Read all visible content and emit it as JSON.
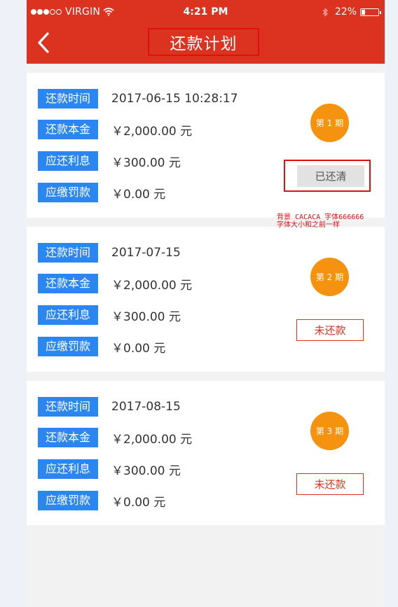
{
  "status_bar": {
    "carrier": "VIRGIN",
    "time": "4:21 PM",
    "battery_pct": "22%",
    "battery_level": 0.22
  },
  "header": {
    "title": "还款计划",
    "back_icon": "chevron-left-icon"
  },
  "colors": {
    "header_bg": "#dc3220",
    "label_bg": "#2b86f2",
    "period_badge": "#f5920f",
    "paid_bg": "#e2e2e2",
    "annotation": "#e01010"
  },
  "plans": [
    {
      "period": "第 1 期",
      "status": "已还清",
      "fields": [
        {
          "label": "还款时间",
          "value": "2017-06-15  10:28:17"
        },
        {
          "label": "还款本金",
          "value": "￥2,000.00 元"
        },
        {
          "label": "应还利息",
          "value": "￥300.00 元"
        },
        {
          "label": "应缴罚款",
          "value": "￥0.00 元"
        }
      ]
    },
    {
      "period": "第 2 期",
      "status": "未还款",
      "fields": [
        {
          "label": "还款时间",
          "value": "2017-07-15"
        },
        {
          "label": "还款本金",
          "value": "￥2,000.00 元"
        },
        {
          "label": "应还利息",
          "value": "￥300.00 元"
        },
        {
          "label": "应缴罚款",
          "value": "￥0.00 元"
        }
      ]
    },
    {
      "period": "第 3 期",
      "status": "未还款",
      "fields": [
        {
          "label": "还款时间",
          "value": "2017-08-15"
        },
        {
          "label": "还款本金",
          "value": "￥2,000.00 元"
        },
        {
          "label": "应还利息",
          "value": "￥300.00 元"
        },
        {
          "label": "应缴罚款",
          "value": "￥0.00 元"
        }
      ]
    }
  ],
  "annotation": {
    "line1": "背景 CACACA  字体666666",
    "line2": "字体大小和之前一样"
  }
}
